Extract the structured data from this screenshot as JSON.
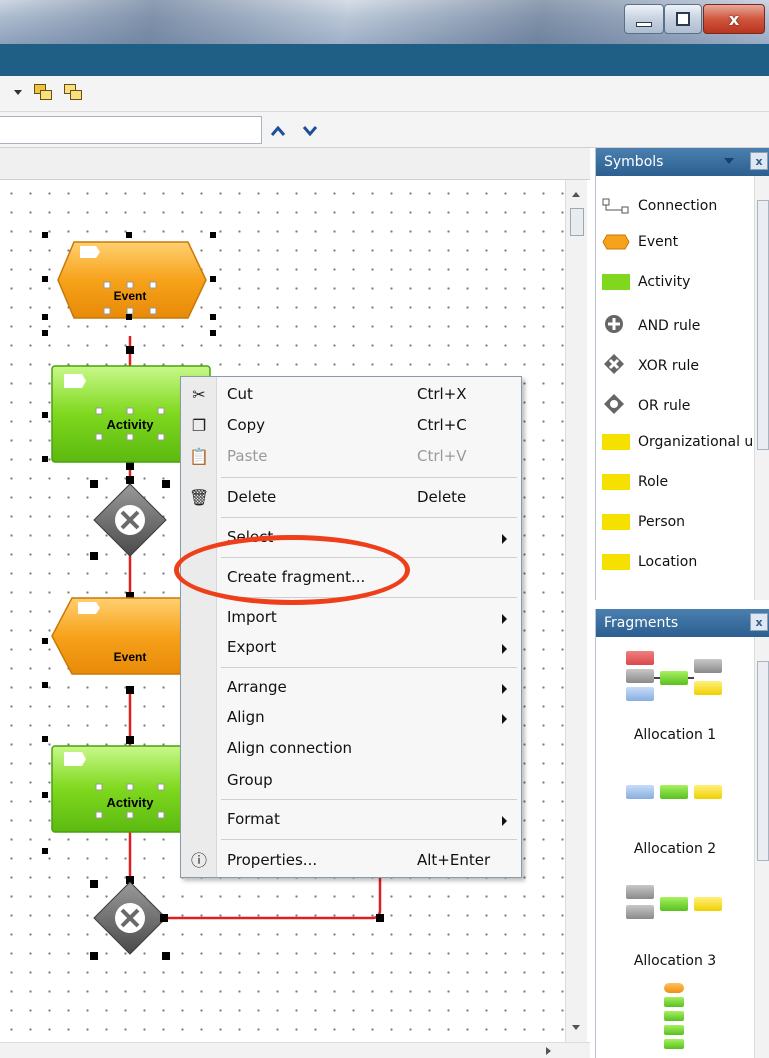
{
  "window": {
    "minimize_icon": "minimize-icon",
    "maximize_icon": "maximize-icon",
    "close_label": "x"
  },
  "toolbar": {
    "search": {
      "value": "",
      "placeholder": ""
    },
    "nav_up": "⌃",
    "nav_down": "⌄"
  },
  "diagram": {
    "shapes": [
      {
        "type": "event",
        "label": "Event"
      },
      {
        "type": "activity",
        "label": "Activity"
      },
      {
        "type": "xor",
        "label": ""
      },
      {
        "type": "event",
        "label": "Event"
      },
      {
        "type": "activity",
        "label": "Activity"
      },
      {
        "type": "xor",
        "label": ""
      }
    ],
    "colors": {
      "event": "#f7a21b",
      "activity": "#7fd81e",
      "connector": "#e02020",
      "gateway": "#6a6a6a"
    }
  },
  "context_menu": {
    "items": [
      {
        "icon": "scissors-icon",
        "glyph": "✂",
        "label": "Cut",
        "shortcut": "Ctrl+X",
        "enabled": true
      },
      {
        "icon": "copy-icon",
        "glyph": "❐",
        "label": "Copy",
        "shortcut": "Ctrl+C",
        "enabled": true
      },
      {
        "icon": "paste-icon",
        "glyph": "📋",
        "label": "Paste",
        "shortcut": "Ctrl+V",
        "enabled": false
      },
      {
        "icon": "trash-icon",
        "glyph": "🗑",
        "label": "Delete",
        "shortcut": "Delete",
        "enabled": true
      },
      {
        "label": "Select",
        "submenu": true
      },
      {
        "label": "Create fragment...",
        "highlighted": true
      },
      {
        "label": "Import",
        "submenu": true
      },
      {
        "label": "Export",
        "submenu": true
      },
      {
        "label": "Arrange",
        "submenu": true
      },
      {
        "label": "Align",
        "submenu": true
      },
      {
        "label": "Align connection"
      },
      {
        "label": "Group"
      },
      {
        "label": "Format",
        "submenu": true
      },
      {
        "icon": "info-icon",
        "glyph": "ⓘ",
        "label": "Properties...",
        "shortcut": "Alt+Enter",
        "enabled": true
      }
    ],
    "highlight_color": "#ee3f1a"
  },
  "symbols_pane": {
    "title": "Symbols",
    "close": "x",
    "items": [
      {
        "label": "Connection",
        "icon": "connection-icon"
      },
      {
        "label": "Event",
        "icon": "event-icon"
      },
      {
        "label": "Activity",
        "icon": "activity-icon"
      },
      {
        "label": "AND rule",
        "icon": "and-rule-icon"
      },
      {
        "label": "XOR rule",
        "icon": "xor-rule-icon"
      },
      {
        "label": "OR rule",
        "icon": "or-rule-icon"
      },
      {
        "label": "Organizational ur",
        "icon": "organizational-unit-icon"
      },
      {
        "label": "Role",
        "icon": "role-icon"
      },
      {
        "label": "Person",
        "icon": "person-icon"
      },
      {
        "label": "Location",
        "icon": "location-icon"
      }
    ]
  },
  "fragments_pane": {
    "title": "Fragments",
    "close": "x",
    "items": [
      {
        "label": "Allocation 1"
      },
      {
        "label": "Allocation 2"
      },
      {
        "label": "Allocation 3"
      }
    ]
  }
}
